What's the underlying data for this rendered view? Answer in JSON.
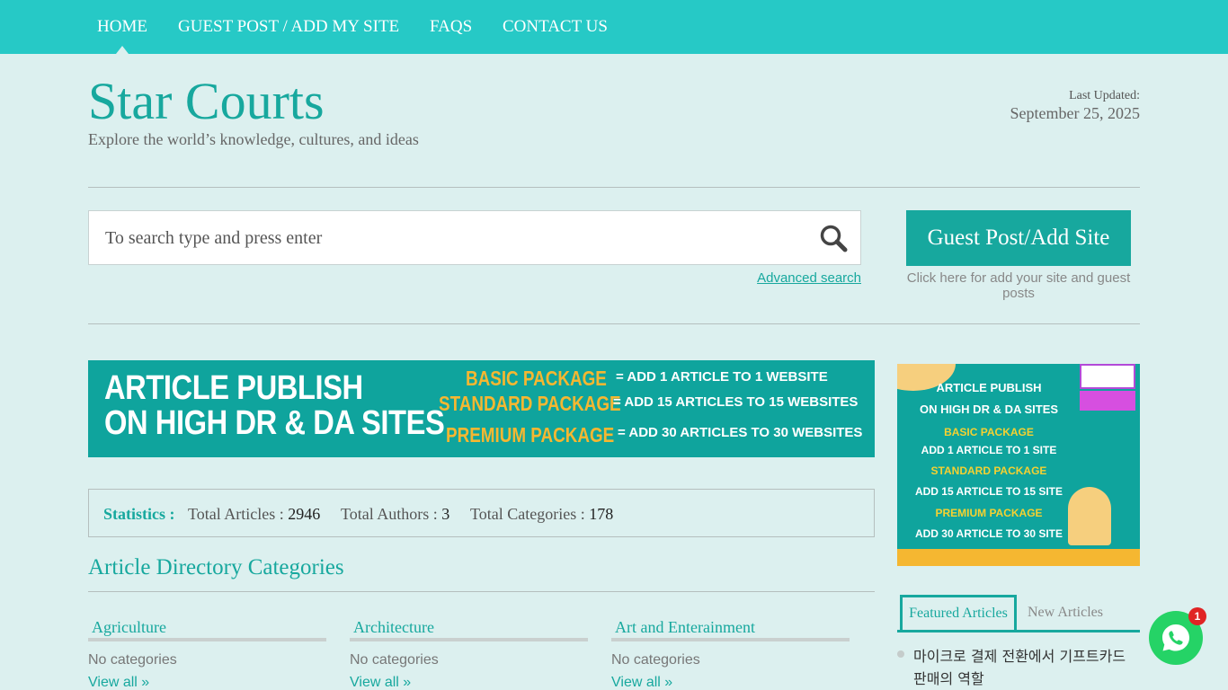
{
  "nav": {
    "items": [
      {
        "label": "HOME",
        "active": true
      },
      {
        "label": "GUEST POST / ADD MY SITE"
      },
      {
        "label": "FAQS"
      },
      {
        "label": "CONTACT US"
      }
    ]
  },
  "header": {
    "title": "Star Courts",
    "tagline": "Explore the world’s knowledge, cultures, and ideas",
    "updated_label": "Last Updated:",
    "updated_date": "September 25, 2025"
  },
  "search": {
    "placeholder": "To search type and press enter",
    "advanced_label": "Advanced search",
    "icon": "search-icon"
  },
  "guest_post": {
    "button_label": "Guest Post/Add Site",
    "note": "Click here for add your site and guest posts"
  },
  "banner_wide": {
    "title_line1": "ARTICLE PUBLISH",
    "title_line2": "ON HIGH DR & DA SITES",
    "packages": [
      {
        "name": "BASIC PACKAGE",
        "desc": "= ADD 1 ARTICLE TO 1 WEBSITE"
      },
      {
        "name": "STANDARD PACKAGE",
        "desc": "= ADD 15 ARTICLES TO 15 WEBSITES"
      },
      {
        "name": "PREMIUM PACKAGE",
        "desc": "= ADD 30 ARTICLES TO 30 WEBSITES"
      }
    ]
  },
  "banner_side": {
    "title_line1": "ARTICLE PUBLISH",
    "title_line2": "ON HIGH DR & DA SITES",
    "basic": "BASIC PACKAGE",
    "basic_desc": "ADD 1 ARTICLE TO 1 SITE",
    "standard": "STANDARD PACKAGE",
    "standard_desc": "ADD 15 ARTICLE TO 15 SITE",
    "premium": "PREMIUM PACKAGE",
    "premium_desc": "ADD 30 ARTICLE TO 30 SITE"
  },
  "stats": {
    "label": "Statistics :",
    "articles_label": "Total Articles :",
    "articles_value": "2946",
    "authors_label": "Total Authors :",
    "authors_value": "3",
    "categories_label": "Total Categories :",
    "categories_value": "178"
  },
  "directory": {
    "title": "Article Directory Categories",
    "categories": [
      {
        "name": "Agriculture",
        "sub": "No categories",
        "link": "View all »"
      },
      {
        "name": "Architecture",
        "sub": "No categories",
        "link": "View all »"
      },
      {
        "name": "Art and Enterainment",
        "sub": "No categories",
        "link": "View all »"
      }
    ]
  },
  "sidebar_tabs": {
    "featured": "Featured Articles",
    "new": "New Articles"
  },
  "featured_articles": [
    {
      "title": "마이크로 결제 전환에서 기프트카드 판매의 역할"
    }
  ],
  "chat": {
    "badge": "1",
    "icon": "whatsapp-icon"
  },
  "colors": {
    "accent": "#17a89e",
    "nav_bg": "#26c9c6",
    "page_bg": "#dcf0ef",
    "banner_yellow": "#f5b731",
    "chat_green": "#25d366"
  }
}
